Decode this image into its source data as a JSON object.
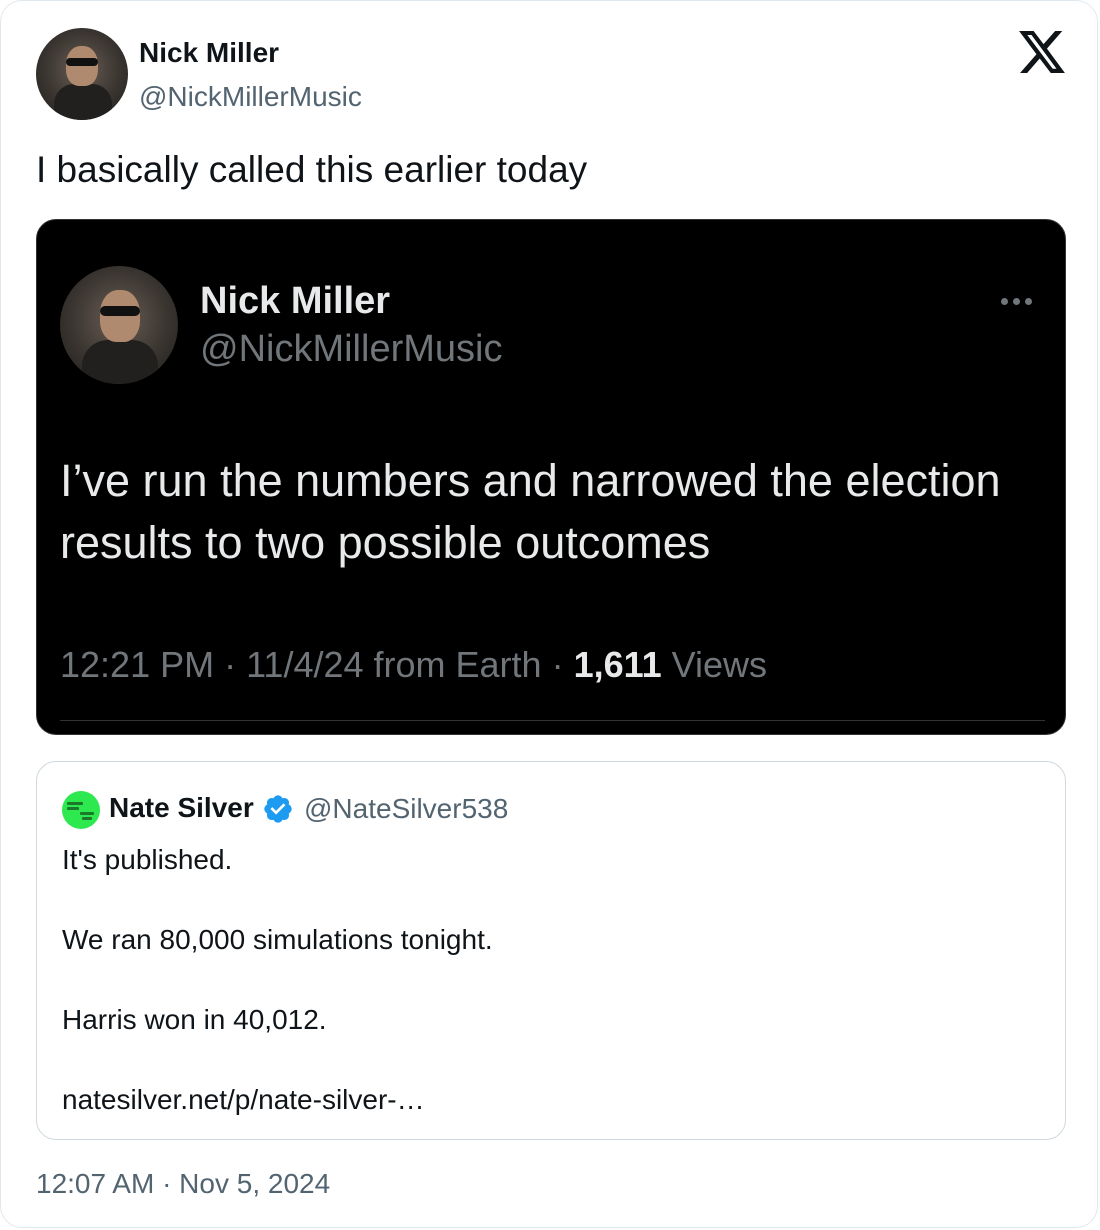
{
  "tweet": {
    "author_name": "Nick Miller",
    "author_handle": "@NickMillerMusic",
    "text": "I basically called this earlier today",
    "timestamp": "12:07 AM · Nov 5, 2024",
    "platform_icon": "x-logo-icon"
  },
  "embedded_screenshot": {
    "author_name": "Nick Miller",
    "author_handle": "@NickMillerMusic",
    "text": "I’ve run the numbers and narrowed the election results to two possible outcomes",
    "meta_time": "12:21 PM · 11/4/24 from Earth · ",
    "views_count": "1,611",
    "views_label": " Views"
  },
  "quoted_tweet": {
    "author_name": "Nate Silver",
    "author_handle": "@NateSilver538",
    "verified": true,
    "paragraphs": [
      "It's published.",
      "We ran 80,000 simulations tonight.",
      "Harris won in 40,012.",
      "natesilver.net/p/nate-silver-…"
    ]
  },
  "colors": {
    "text_primary": "#0f1419",
    "text_secondary": "#536471",
    "verified_blue": "#1d9bf0",
    "dark_bg": "#000000",
    "avatar_green": "#2ee84f"
  }
}
